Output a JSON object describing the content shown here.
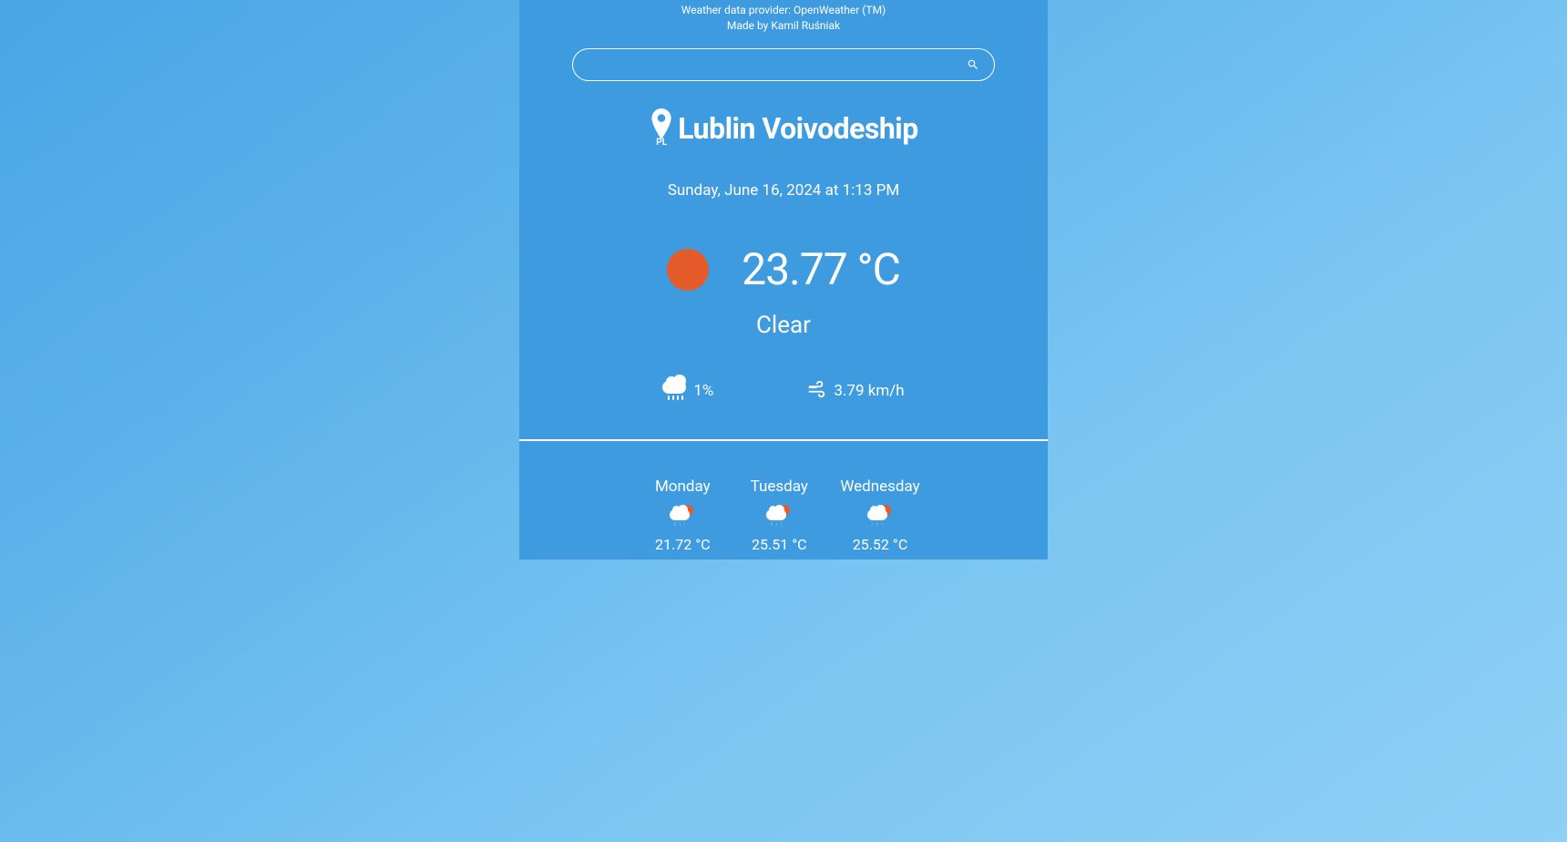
{
  "header": {
    "provider_line": "Weather data provider: OpenWeather (TM)",
    "author_line": "Made by Kamil Ruśniak"
  },
  "search": {
    "value": "",
    "placeholder": ""
  },
  "location": {
    "country_code": "PL",
    "name": "Lublin Voivodeship"
  },
  "datetime": "Sunday, June 16, 2024 at 1:13 PM",
  "current": {
    "temperature": "23.77 °C",
    "condition": "Clear",
    "precipitation": "1%",
    "wind": "3.79 km/h"
  },
  "forecast": [
    {
      "day": "Monday",
      "temp": "21.72 °C",
      "icon": "rain-sun"
    },
    {
      "day": "Tuesday",
      "temp": "25.51 °C",
      "icon": "rain-sun"
    },
    {
      "day": "Wednesday",
      "temp": "25.52 °C",
      "icon": "rain-sun"
    }
  ]
}
